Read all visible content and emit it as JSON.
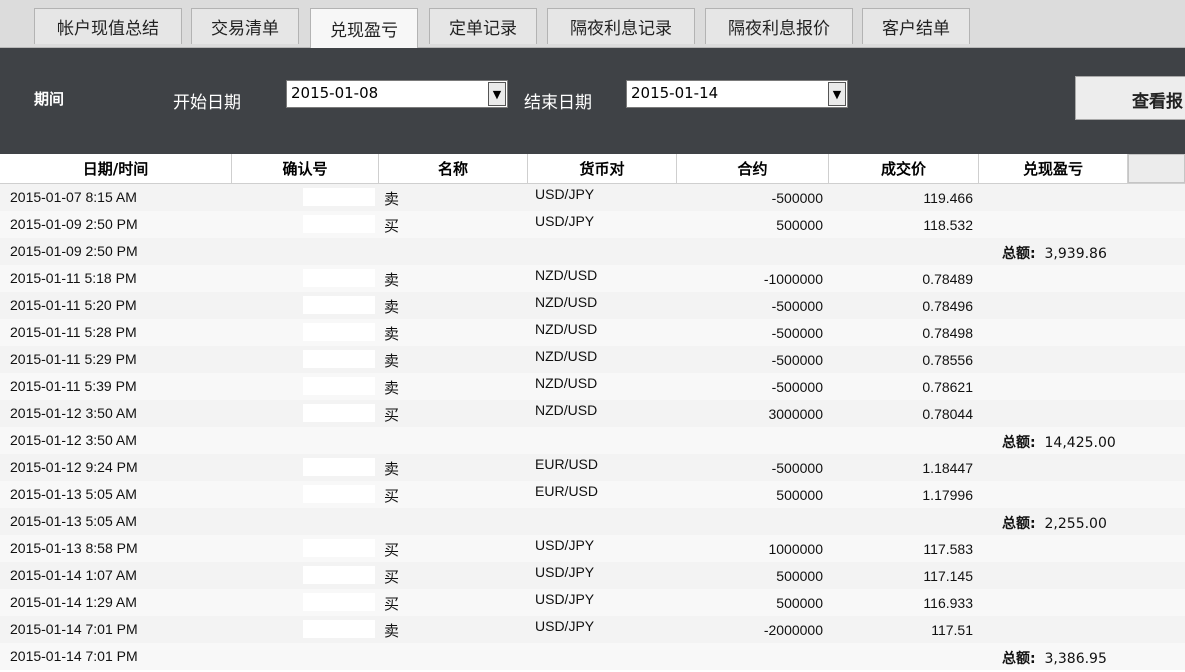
{
  "tabs": [
    {
      "label": "帐户现值总结",
      "active": false
    },
    {
      "label": "交易清单",
      "active": false
    },
    {
      "label": "兑现盈亏",
      "active": true
    },
    {
      "label": "定单记录",
      "active": false
    },
    {
      "label": "隔夜利息记录",
      "active": false
    },
    {
      "label": "隔夜利息报价",
      "active": false
    },
    {
      "label": "客户结单",
      "active": false
    }
  ],
  "filter": {
    "period_label": "期间",
    "start_label": "开始日期",
    "start_value": "2015-01-08",
    "end_label": "结束日期",
    "end_value": "2015-01-14",
    "view_button": "查看报"
  },
  "table": {
    "columns": [
      "日期/时间",
      "确认号",
      "名称",
      "货币对",
      "合约",
      "成交价",
      "兑现盈亏"
    ],
    "total_label": "总额:",
    "rows": [
      {
        "datetime": "2015-01-07 8:15 AM",
        "side": "卖",
        "pair": "USD/JPY",
        "contract": "-500000",
        "price": "119.466",
        "total": ""
      },
      {
        "datetime": "2015-01-09 2:50 PM",
        "side": "买",
        "pair": "USD/JPY",
        "contract": "500000",
        "price": "118.532",
        "total": ""
      },
      {
        "datetime": "2015-01-09 2:50 PM",
        "side": "",
        "pair": "",
        "contract": "",
        "price": "",
        "total": "3,939.86"
      },
      {
        "datetime": "2015-01-11 5:18 PM",
        "side": "卖",
        "pair": "NZD/USD",
        "contract": "-1000000",
        "price": "0.78489",
        "total": ""
      },
      {
        "datetime": "2015-01-11 5:20 PM",
        "side": "卖",
        "pair": "NZD/USD",
        "contract": "-500000",
        "price": "0.78496",
        "total": ""
      },
      {
        "datetime": "2015-01-11 5:28 PM",
        "side": "卖",
        "pair": "NZD/USD",
        "contract": "-500000",
        "price": "0.78498",
        "total": ""
      },
      {
        "datetime": "2015-01-11 5:29 PM",
        "side": "卖",
        "pair": "NZD/USD",
        "contract": "-500000",
        "price": "0.78556",
        "total": ""
      },
      {
        "datetime": "2015-01-11 5:39 PM",
        "side": "卖",
        "pair": "NZD/USD",
        "contract": "-500000",
        "price": "0.78621",
        "total": ""
      },
      {
        "datetime": "2015-01-12 3:50 AM",
        "side": "买",
        "pair": "NZD/USD",
        "contract": "3000000",
        "price": "0.78044",
        "total": ""
      },
      {
        "datetime": "2015-01-12 3:50 AM",
        "side": "",
        "pair": "",
        "contract": "",
        "price": "",
        "total": "14,425.00"
      },
      {
        "datetime": "2015-01-12 9:24 PM",
        "side": "卖",
        "pair": "EUR/USD",
        "contract": "-500000",
        "price": "1.18447",
        "total": ""
      },
      {
        "datetime": "2015-01-13 5:05 AM",
        "side": "买",
        "pair": "EUR/USD",
        "contract": "500000",
        "price": "1.17996",
        "total": ""
      },
      {
        "datetime": "2015-01-13 5:05 AM",
        "side": "",
        "pair": "",
        "contract": "",
        "price": "",
        "total": "2,255.00"
      },
      {
        "datetime": "2015-01-13 8:58 PM",
        "side": "买",
        "pair": "USD/JPY",
        "contract": "1000000",
        "price": "117.583",
        "total": ""
      },
      {
        "datetime": "2015-01-14 1:07 AM",
        "side": "买",
        "pair": "USD/JPY",
        "contract": "500000",
        "price": "117.145",
        "total": ""
      },
      {
        "datetime": "2015-01-14 1:29 AM",
        "side": "买",
        "pair": "USD/JPY",
        "contract": "500000",
        "price": "116.933",
        "total": ""
      },
      {
        "datetime": "2015-01-14 7:01 PM",
        "side": "卖",
        "pair": "USD/JPY",
        "contract": "-2000000",
        "price": "117.51",
        "total": ""
      },
      {
        "datetime": "2015-01-14 7:01 PM",
        "side": "",
        "pair": "",
        "contract": "",
        "price": "",
        "total": "3,386.95"
      }
    ]
  }
}
